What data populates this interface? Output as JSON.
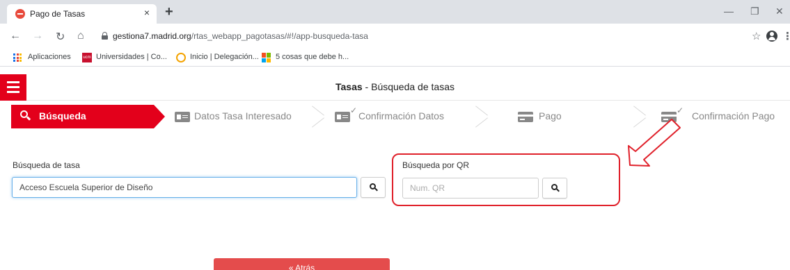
{
  "browser": {
    "tab_title": "Pago de Tasas",
    "tab_close": "×",
    "new_tab": "+",
    "url_host": "gestiona7.madrid.org",
    "url_path": "/rtas_webapp_pagotasas/#!/app-busqueda-tasa",
    "bookmarks": [
      {
        "label": "Aplicaciones",
        "icon": "apps-grid-icon"
      },
      {
        "label": "Universidades | Co...",
        "icon": "ucm-icon"
      },
      {
        "label": "Inicio | Delegación...",
        "icon": "delegacion-icon"
      },
      {
        "label": "5 cosas que debe h...",
        "icon": "windows-icon"
      }
    ]
  },
  "app": {
    "title_bold": "Tasas",
    "title_rest": " - Búsqueda de tasas",
    "accent_color": "#e3001b"
  },
  "steps": [
    {
      "label": "Búsqueda",
      "active": true,
      "icon": "search-icon"
    },
    {
      "label": "Datos Tasa Interesado",
      "active": false,
      "icon": "id-card-icon"
    },
    {
      "label": "Confirmación Datos",
      "active": false,
      "icon": "id-card-check-icon"
    },
    {
      "label": "Pago",
      "active": false,
      "icon": "credit-card-icon"
    },
    {
      "label": "Confirmación Pago",
      "active": false,
      "icon": "credit-card-check-icon"
    }
  ],
  "search_tasa": {
    "label": "Búsqueda de tasa",
    "value": "Acceso Escuela Superior de Diseño"
  },
  "search_qr": {
    "label": "Búsqueda por QR",
    "placeholder": "Num. QR"
  },
  "back_button": {
    "label": "« Atrás"
  }
}
